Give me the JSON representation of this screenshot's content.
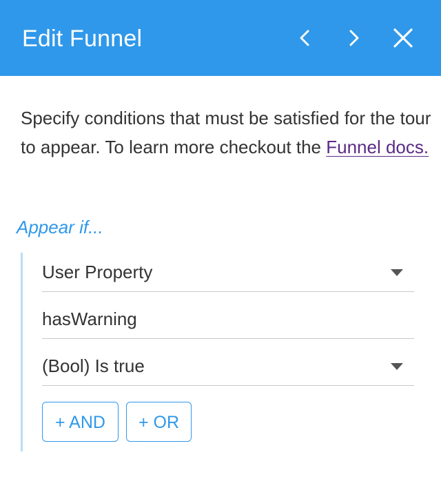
{
  "header": {
    "title": "Edit Funnel",
    "prev_icon": "chevron-left-icon",
    "next_icon": "chevron-right-icon",
    "close_icon": "close-icon",
    "background": "#2f98ea"
  },
  "intro": {
    "text": "Specify conditions that must be satisfied for the tour to appear. To learn more checkout the ",
    "link_text": "Funnel docs."
  },
  "section": {
    "heading": "Appear if..."
  },
  "condition": {
    "type_select": "User Property",
    "property_input": "hasWarning",
    "operator_select": "(Bool) Is true"
  },
  "buttons": {
    "and_label": "+ AND",
    "or_label": "+ OR"
  },
  "colors": {
    "accent": "#2f98ea",
    "link": "#5b2a86",
    "group_border": "#b9dcf5"
  }
}
